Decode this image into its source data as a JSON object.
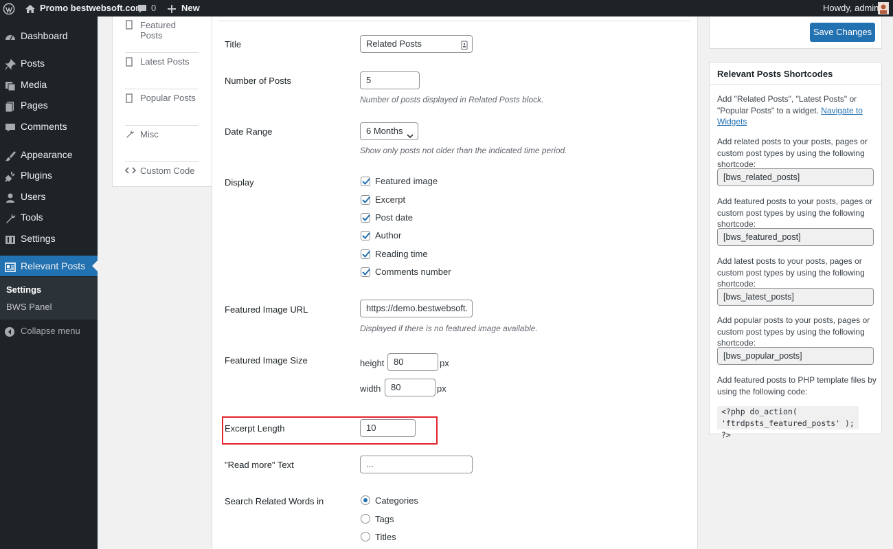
{
  "admin_bar": {
    "site_name": "Promo bestwebsoft.com",
    "comments_count": "0",
    "new_label": "New",
    "greeting": "Howdy, admin"
  },
  "sidebar": {
    "items": [
      {
        "label": "Dashboard",
        "icon": "dashboard-icon"
      },
      {
        "label": "Posts",
        "icon": "pin-icon"
      },
      {
        "label": "Media",
        "icon": "media-icon"
      },
      {
        "label": "Pages",
        "icon": "pages-icon"
      },
      {
        "label": "Comments",
        "icon": "comment-icon"
      },
      {
        "label": "Appearance",
        "icon": "brush-icon"
      },
      {
        "label": "Plugins",
        "icon": "plug-icon"
      },
      {
        "label": "Users",
        "icon": "user-icon"
      },
      {
        "label": "Tools",
        "icon": "wrench-icon"
      },
      {
        "label": "Settings",
        "icon": "settings-icon"
      },
      {
        "label": "Relevant Posts",
        "icon": "relevant-posts-icon"
      }
    ],
    "submenu": [
      "Settings",
      "BWS Panel"
    ],
    "collapse_label": "Collapse menu"
  },
  "tabs": [
    "Featured Posts",
    "Latest Posts",
    "Popular Posts",
    "Misc",
    "Custom Code"
  ],
  "form": {
    "title": {
      "label": "Title",
      "value": "Related Posts"
    },
    "number_of_posts": {
      "label": "Number of Posts",
      "value": "5",
      "description": "Number of posts displayed in Related Posts block."
    },
    "date_range": {
      "label": "Date Range",
      "value": "6 Months",
      "description": "Show only posts not older than the indicated time period."
    },
    "display": {
      "label": "Display",
      "options": [
        "Featured image",
        "Excerpt",
        "Post date",
        "Author",
        "Reading time",
        "Comments number"
      ]
    },
    "featured_image_url": {
      "label": "Featured Image URL",
      "value": "https://demo.bestwebsoft.",
      "description": "Displayed if there is no featured image available."
    },
    "featured_image_size": {
      "label": "Featured Image Size",
      "height_label": "height",
      "height_value": "80",
      "width_label": "width",
      "width_value": "80",
      "unit": "px"
    },
    "excerpt_length": {
      "label": "Excerpt Length",
      "value": "10"
    },
    "read_more": {
      "label": "\"Read more\" Text",
      "value": "..."
    },
    "search_related": {
      "label": "Search Related Words in",
      "options": [
        "Categories",
        "Tags",
        "Titles"
      ],
      "selected": "Categories"
    }
  },
  "save_button": "Save Changes",
  "shortcodes": {
    "header": "Relevant Posts Shortcodes",
    "intro": "Add \"Related Posts\", \"Latest Posts\" or \"Popular Posts\" to a widget.",
    "intro_link": "Navigate to Widgets",
    "related_text": "Add related posts to your posts, pages or custom post types by using the following shortcode:",
    "related_code": "[bws_related_posts]",
    "featured_text": "Add featured posts to your posts, pages or custom post types by using the following shortcode:",
    "featured_code": "[bws_featured_post]",
    "latest_text": "Add latest posts to your posts, pages or custom post types by using the following shortcode:",
    "latest_code": "[bws_latest_posts]",
    "popular_text": "Add popular posts to your posts, pages or custom post types by using the following shortcode:",
    "popular_code": "[bws_popular_posts]",
    "php_text": "Add featured posts to PHP template files by using the following code:",
    "php_code_line1": "<?php do_action(",
    "php_code_line2": "'ftrdpsts_featured_posts' ); ?>"
  }
}
